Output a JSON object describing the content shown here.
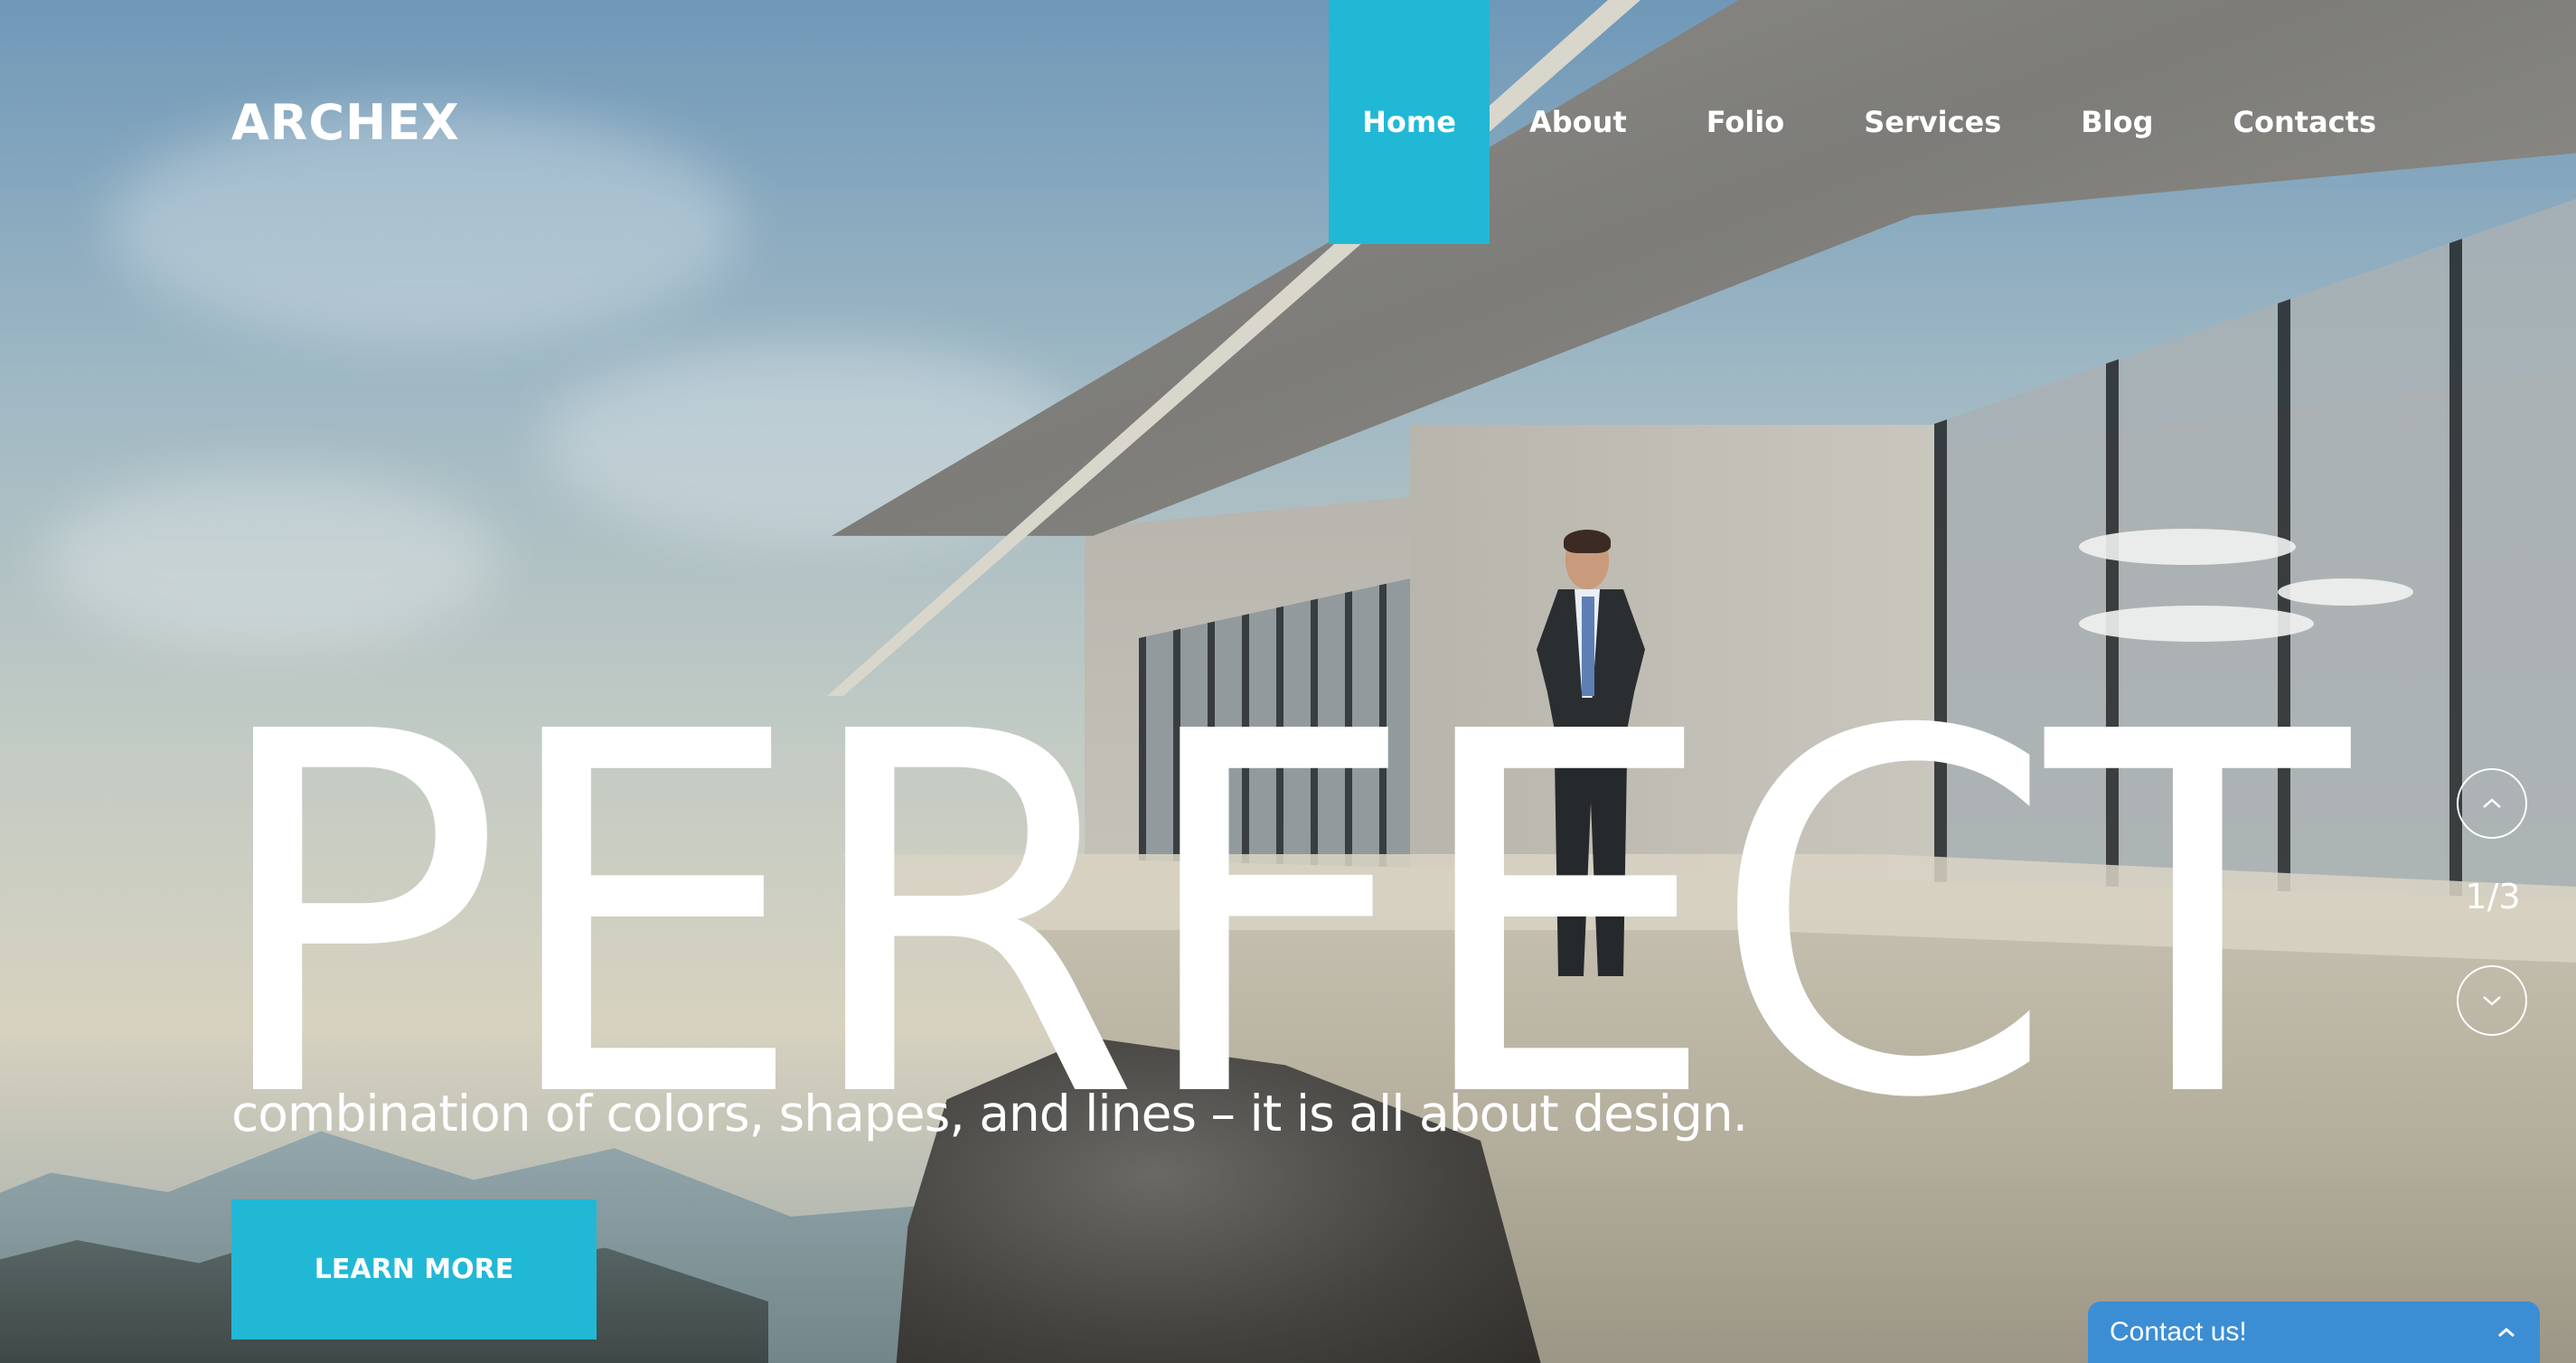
{
  "header": {
    "logo": "ARCHEX",
    "nav": [
      {
        "label": "Home",
        "active": true
      },
      {
        "label": "About",
        "active": false
      },
      {
        "label": "Folio",
        "active": false
      },
      {
        "label": "Services",
        "active": false
      },
      {
        "label": "Blog",
        "active": false
      },
      {
        "label": "Contacts",
        "active": false
      }
    ]
  },
  "hero": {
    "headline": "PERFECT",
    "subline": "combination of colors, shapes, and lines – it is all about design.",
    "cta_label": "LEARN MORE"
  },
  "slider": {
    "counter": "1/3",
    "prev_icon": "chevron-up-icon",
    "next_icon": "chevron-down-icon"
  },
  "contact_widget": {
    "label": "Contact us!",
    "icon": "chevron-up-icon"
  },
  "colors": {
    "accent": "#21b8d6",
    "widget": "#3c8ed4",
    "text": "#ffffff"
  }
}
